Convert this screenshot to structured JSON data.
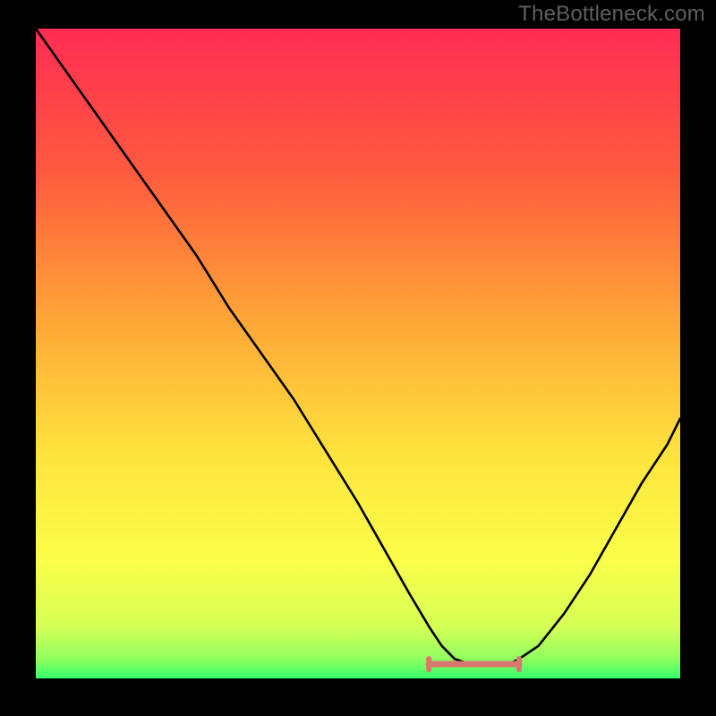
{
  "watermark": {
    "text": "TheBottleneck.com"
  },
  "chart_data": {
    "type": "line",
    "title": "",
    "xlabel": "",
    "ylabel": "",
    "xlim": [
      0,
      100
    ],
    "ylim": [
      0,
      100
    ],
    "grid": false,
    "legend": false,
    "series": [
      {
        "name": "bottleneck-curve",
        "x": [
          0,
          5,
          10,
          15,
          20,
          25,
          30,
          35,
          40,
          45,
          50,
          54,
          58,
          61,
          63,
          65,
          68,
          71,
          73,
          75,
          78,
          82,
          86,
          90,
          94,
          98,
          100
        ],
        "y": [
          100,
          93,
          86,
          79,
          72,
          65,
          57,
          50,
          43,
          35,
          27,
          20,
          13,
          8,
          5,
          3,
          2,
          2,
          2,
          3,
          5,
          10,
          16,
          23,
          30,
          36,
          40
        ]
      }
    ],
    "annotations": [
      {
        "name": "optimal-band",
        "x_range": [
          61,
          75
        ],
        "y": 2.2
      }
    ],
    "gradient_stops": [
      {
        "pct": 0,
        "color": "#ff2c54"
      },
      {
        "pct": 22,
        "color": "#ff5a3f"
      },
      {
        "pct": 45,
        "color": "#ffa637"
      },
      {
        "pct": 65,
        "color": "#ffe23d"
      },
      {
        "pct": 82,
        "color": "#faff4a"
      },
      {
        "pct": 92,
        "color": "#d6ff55"
      },
      {
        "pct": 97,
        "color": "#8fff60"
      },
      {
        "pct": 100,
        "color": "#36ff6a"
      }
    ]
  }
}
